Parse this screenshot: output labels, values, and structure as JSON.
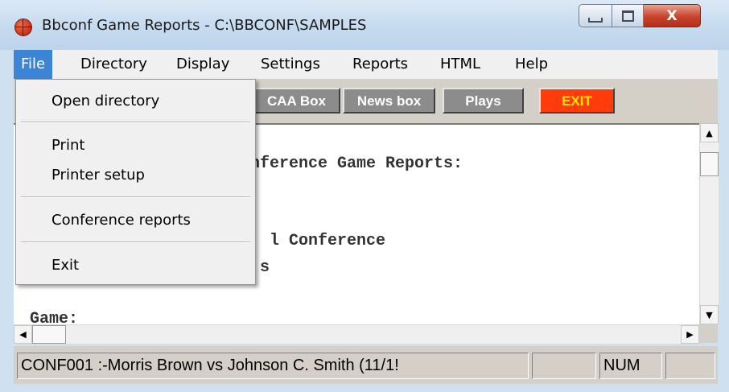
{
  "window": {
    "title": "Bbconf Game Reports - C:\\BBCONF\\SAMPLES",
    "app_icon": "basketball-icon"
  },
  "caption_buttons": {
    "close_label": "X"
  },
  "menu": [
    "File",
    "Directory",
    "Display",
    "Settings",
    "Reports",
    "HTML",
    "Help"
  ],
  "file_menu": [
    "Open directory",
    "Print",
    "Printer setup",
    "Conference reports",
    "Exit"
  ],
  "toolbar": {
    "ncaa_box": "CAA Box",
    "news_box": "News box",
    "plays": "Plays",
    "exit": "EXIT"
  },
  "content_lines": [
    "nference Game Reports:",
    "l Conference",
    "s",
    "Game:"
  ],
  "status": {
    "file": "CONF001 :-Morris Brown vs Johnson C. Smith (11/1!",
    "num": "NUM"
  },
  "colors": {
    "menu_highlight": "#3b84d6",
    "exit_bg": "#ff3c0a",
    "exit_text": "#ffe600",
    "toolbar_btn": "#8c8c8c"
  }
}
